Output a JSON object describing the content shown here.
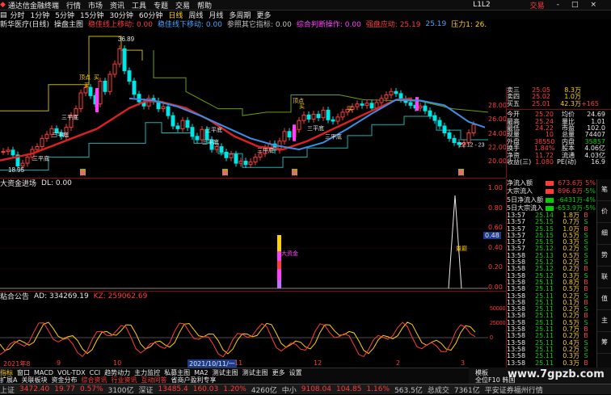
{
  "titlebar": {
    "app_name": "通达信金融终端",
    "menus": [
      "行情",
      "市场",
      "资讯",
      "工具",
      "专题",
      "交易",
      "帮助"
    ],
    "user": "L1L2",
    "trade_label": "交易",
    "window_controls": [
      "-",
      "□",
      "×"
    ]
  },
  "periods": [
    "分时",
    "1分钟",
    "5分钟",
    "15分钟",
    "30分钟",
    "60分钟",
    "日线",
    "周线",
    "月线",
    "多周期",
    "更多"
  ],
  "selected_period": "日线",
  "main_panel": {
    "stock_title": "新华医疗(日线)",
    "indicator": "操盘主图",
    "items": [
      {
        "text": "稳佳线上移动: 0.00",
        "color": "#ff3c3c"
      },
      {
        "text": "稳佳线下移动: 0.00",
        "color": "#4aa3ff"
      },
      {
        "text": "参照其它指标: 0.00",
        "color": "#c0c0c0"
      },
      {
        "text": "综合判断操作: 0.00",
        "color": "#ff40ff"
      },
      {
        "text": "强盘应动: 25.19",
        "color": "#ff3c3c"
      },
      {
        "text": "25.19",
        "color": "#4aa3ff"
      },
      {
        "text": "压力1: 26.",
        "color": "#ffd200"
      }
    ],
    "price_high_label": "36.89",
    "price_low_label": "18.95",
    "last_label": "22.12 - 23",
    "axis": [
      "28.00",
      "26.00",
      "24.00",
      "22.00",
      "20.00"
    ],
    "markers": [
      "三平底",
      "三平底",
      "三平底",
      "三平底",
      "三平底",
      "三平底",
      "三平底",
      "三平底",
      "买",
      "买",
      "买",
      "买",
      "顶点",
      "顶点"
    ],
    "signals": [
      "跌",
      "跌",
      "跌",
      "跌"
    ]
  },
  "flow_panel": {
    "title": "大资金进场",
    "dl": "DL: 0.00",
    "bar_label": "大资金",
    "peak_label": "量巅",
    "axis": [
      "1.00",
      "0.80",
      "0.60",
      "0.40",
      "0.20",
      "0.00"
    ],
    "cur_value": "0.48"
  },
  "ad_panel": {
    "title": "粘合公告",
    "ad": "AD: 334269.19",
    "kz": "KZ: 259062.69",
    "axis": [
      "50000",
      "25000",
      "0"
    ]
  },
  "date_axis": {
    "labels": [
      "2021年8",
      "9",
      "10",
      "2021/10/11/一",
      "11",
      "12",
      "2",
      "3"
    ]
  },
  "quote": {
    "top_rows": [
      {
        "k": "卖三",
        "v": "25.05",
        "v2": "8.3万"
      },
      {
        "k": "卖四",
        "v": "25.02",
        "v2": "1.0万"
      },
      {
        "k": "买五",
        "v": "25.01",
        "v2": "42.3万",
        "extra": "+165"
      }
    ],
    "fields": [
      {
        "k": "今开",
        "v": "25.20",
        "k2": "均价",
        "v2": "24.69"
      },
      {
        "k": "最高",
        "v": "25.24",
        "k2": "量比",
        "v2": "1.01"
      },
      {
        "k": "最低",
        "v": "24.22",
        "k2": "市盈",
        "v2": "102.0"
      },
      {
        "k": "现量",
        "v": "10",
        "k2": "总量",
        "v2": "74407"
      },
      {
        "k": "外盘",
        "v": "38550",
        "k2": "内盘",
        "v2": "35857"
      },
      {
        "k": "换手",
        "v": "1.84%",
        "k2": "股本",
        "v2": "4.06亿"
      },
      {
        "k": "净资",
        "v": "11.72",
        "k2": "流通",
        "v2": "4.03亿"
      },
      {
        "k": "收益(三)",
        "v": "1.080",
        "k2": "PE(动)",
        "v2": "16.9"
      }
    ],
    "flows": [
      {
        "k": "净流入额",
        "v": "673.6万",
        "p": "5%"
      },
      {
        "k": "大宗流入",
        "v": "896.6万",
        "p": "-5%"
      },
      {
        "k": "5日净流入额",
        "v": "-6431万",
        "p": "-4%"
      },
      {
        "k": "5日大宗流入",
        "v": "-653.9万",
        "p": "-5%"
      }
    ],
    "ticks": [
      {
        "t": "13:57",
        "p": "25.14",
        "q": "1.8万",
        "d": "B"
      },
      {
        "t": "13:57",
        "p": "25.15",
        "q": "0.7万",
        "d": "S"
      },
      {
        "t": "13:57",
        "p": "25.15",
        "q": "1.0万",
        "d": "B"
      },
      {
        "t": "13:57",
        "p": "25.15",
        "q": "0.5万",
        "d": "S"
      },
      {
        "t": "13:57",
        "p": "25.15",
        "q": "0.3万",
        "d": "S"
      },
      {
        "t": "13:57",
        "p": "25.12",
        "q": "0.2万",
        "d": "S"
      },
      {
        "t": "13:58",
        "p": "25.13",
        "q": "0.5万",
        "d": "S"
      },
      {
        "t": "13:58",
        "p": "25.12",
        "q": "0.2万",
        "d": "S"
      },
      {
        "t": "13:58",
        "p": "25.12",
        "q": "0.2万",
        "d": "B"
      },
      {
        "t": "13:58",
        "p": "25.12",
        "q": "0.3万",
        "d": "S"
      },
      {
        "t": "13:58",
        "p": "25.11",
        "q": "0.8万",
        "d": "B"
      },
      {
        "t": "13:58",
        "p": "25.11",
        "q": "0.5万",
        "d": "B"
      },
      {
        "t": "13:58",
        "p": "25.11",
        "q": "0.2万",
        "d": "S"
      },
      {
        "t": "13:58",
        "p": "25.11",
        "q": "0.1万",
        "d": "B"
      },
      {
        "t": "13:58",
        "p": "25.11",
        "q": "0.2万",
        "d": "S"
      },
      {
        "t": "13:58",
        "p": "25.11",
        "q": "0.2万",
        "d": "B"
      },
      {
        "t": "13:58",
        "p": "25.11",
        "q": "0.5万",
        "d": "S"
      },
      {
        "t": "13:58",
        "p": "25.11",
        "q": "0.7万",
        "d": "B"
      },
      {
        "t": "13:58",
        "p": "25.11",
        "q": "0.2万",
        "d": "B"
      },
      {
        "t": "13:58",
        "p": "25.11",
        "q": "0.4万",
        "d": "S"
      },
      {
        "t": "13:58",
        "p": "25.11",
        "q": "0.2万",
        "d": "S"
      },
      {
        "t": "13:58",
        "p": "25.11",
        "q": "0.3万",
        "d": "S"
      },
      {
        "t": "13:58",
        "p": "25.11",
        "q": "0.3万",
        "d": "B"
      }
    ]
  },
  "tabs": [
    "指标",
    "窗口",
    "MACD",
    "VOL-TDX",
    "CCI",
    "趋势动力",
    "主力监控",
    "私募主图",
    "MA2",
    "测试主图",
    "测试主图",
    "更多",
    "设置"
  ],
  "tabs2": [
    "扩展A",
    "关联板块",
    "资金分布",
    "综合资讯",
    "行业资讯",
    "互动问答",
    "省商户盈利专享"
  ],
  "right_tabs": [
    "笔",
    "价",
    "细",
    "势",
    "联",
    "值",
    "主",
    "筹"
  ],
  "corner_labels": {
    "a": "模板",
    "b": "全位F10 韩国"
  },
  "statusbar": {
    "items": [
      {
        "t": "上证",
        "c": "#c0c0c0"
      },
      {
        "t": "3472.40",
        "c": "#ff3c3c"
      },
      {
        "t": "19.77",
        "c": "#ff3c3c"
      },
      {
        "t": "0.57%",
        "c": "#ff3c3c"
      },
      {
        "t": "3100亿",
        "c": "#c0c0c0"
      },
      {
        "t": "深证",
        "c": "#c0c0c0"
      },
      {
        "t": "13485.4",
        "c": "#ff3c3c"
      },
      {
        "t": "160.03",
        "c": "#ff3c3c"
      },
      {
        "t": "1.20%",
        "c": "#ff3c3c"
      },
      {
        "t": "4260亿",
        "c": "#c0c0c0"
      },
      {
        "t": "中小",
        "c": "#c0c0c0"
      },
      {
        "t": "9108.04",
        "c": "#ff3c3c"
      },
      {
        "t": "104.85",
        "c": "#ff3c3c"
      },
      {
        "t": "1.16%",
        "c": "#ff3c3c"
      },
      {
        "t": "563.5亿",
        "c": "#c0c0c0"
      },
      {
        "t": "总成交",
        "c": "#c0c0c0"
      },
      {
        "t": "7361亿",
        "c": "#c0c0c0"
      },
      {
        "t": "平安证券福州行情",
        "c": "#c0c0c0"
      }
    ]
  },
  "watermark": "www.7gpzb.com",
  "colors": {
    "up": "#ff3c3c",
    "down": "#00e5e5",
    "ma": "#e02020",
    "blue_line": "#3a8ee6",
    "band": "#b8a000"
  }
}
